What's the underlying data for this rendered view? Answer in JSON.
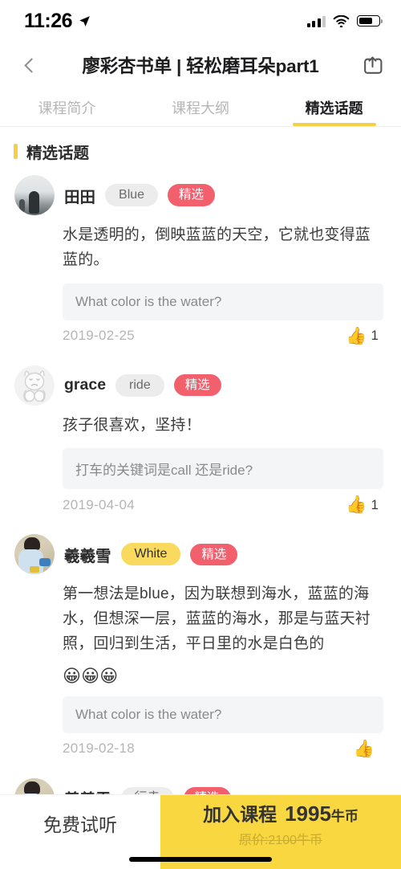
{
  "status_bar": {
    "time": "11:26",
    "location_icon": "location-arrow-icon",
    "signal_icon": "cellular-signal-icon",
    "wifi_icon": "wifi-icon",
    "battery_icon": "battery-icon"
  },
  "nav": {
    "back_icon": "chevron-left-icon",
    "title": "廖彩杏书单 | 轻松磨耳朵part1",
    "share_icon": "share-icon"
  },
  "tabs": [
    {
      "label": "课程简介",
      "active": false
    },
    {
      "label": "课程大纲",
      "active": false
    },
    {
      "label": "精选话题",
      "active": true
    }
  ],
  "section": {
    "title": "精选话题",
    "accent_color": "#f7cf46"
  },
  "posts": [
    {
      "avatar": "seascape-photo-avatar",
      "username": "田田",
      "tag": "Blue",
      "tag_style": "gray",
      "badge": "精选",
      "text": "水是透明的，倒映蓝蓝的天空，它就也变得蓝蓝的。",
      "emoji": "",
      "question": "What color is the water?",
      "date": "2019-02-25",
      "like_icon": "thumbs-up-icon",
      "likes": "1"
    },
    {
      "avatar": "cartoon-line-avatar",
      "username": "grace",
      "tag": "ride",
      "tag_style": "gray",
      "badge": "精选",
      "text": "孩子很喜欢，坚持！",
      "emoji": "",
      "question": "打车的关键词是call 还是ride?",
      "date": "2019-04-04",
      "like_icon": "thumbs-up-icon",
      "likes": "1"
    },
    {
      "avatar": "child-photo-avatar",
      "username": "羲羲雪",
      "tag": "White",
      "tag_style": "yellow",
      "badge": "精选",
      "text": "第一想法是blue，因为联想到海水，蓝蓝的海水，但想深一层，蓝蓝的海水，那是与蓝天衬照，回归到生活，平日里的水是白色的",
      "emoji": "😀😀😀",
      "question": "What color is the water?",
      "date": "2019-02-18",
      "like_icon": "thumbs-up-icon",
      "likes": ""
    },
    {
      "avatar": "child-photo-avatar",
      "username": "羲羲雪",
      "tag": "行走",
      "tag_style": "gray",
      "badge": "精选",
      "text": "",
      "emoji": "",
      "question": "",
      "date": "",
      "like_icon": "thumbs-up-icon",
      "likes": ""
    }
  ],
  "bottom_bar": {
    "trial_label": "免费试听",
    "cta_label": "加入课程",
    "cta_price": "1995",
    "cta_unit": "牛币",
    "cta_original": "原价:2100牛币",
    "cta_color": "#f8d741"
  }
}
